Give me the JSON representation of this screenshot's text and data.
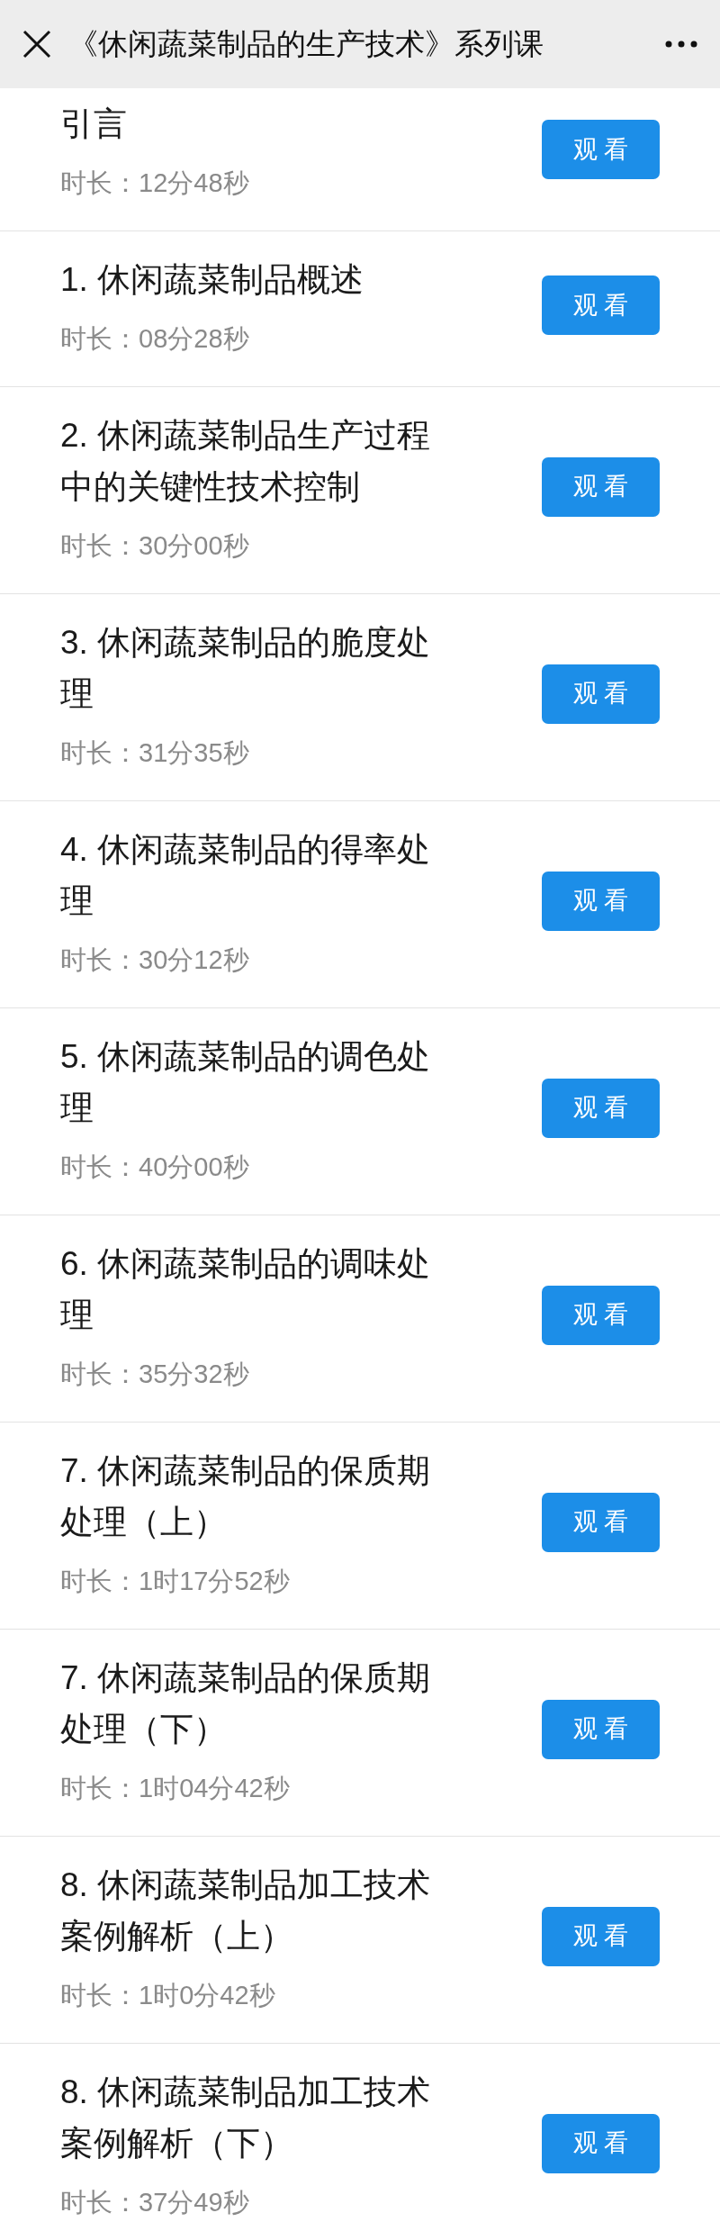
{
  "header": {
    "title": "《休闲蔬菜制品的生产技术》系列课"
  },
  "lessons": [
    {
      "title": "引言",
      "duration": "时长：12分48秒",
      "button": "观 看"
    },
    {
      "title": "1. 休闲蔬菜制品概述",
      "duration": "时长：08分28秒",
      "button": "观 看"
    },
    {
      "title": "2. 休闲蔬菜制品生产过程中的关键性技术控制",
      "duration": "时长：30分00秒",
      "button": "观 看"
    },
    {
      "title": "3. 休闲蔬菜制品的脆度处理",
      "duration": "时长：31分35秒",
      "button": "观 看"
    },
    {
      "title": "4. 休闲蔬菜制品的得率处理",
      "duration": "时长：30分12秒",
      "button": "观 看"
    },
    {
      "title": "5. 休闲蔬菜制品的调色处理",
      "duration": "时长：40分00秒",
      "button": "观 看"
    },
    {
      "title": "6. 休闲蔬菜制品的调味处理",
      "duration": "时长：35分32秒",
      "button": "观 看"
    },
    {
      "title": "7. 休闲蔬菜制品的保质期处理（上）",
      "duration": "时长：1时17分52秒",
      "button": "观 看"
    },
    {
      "title": "7. 休闲蔬菜制品的保质期处理（下）",
      "duration": "时长：1时04分42秒",
      "button": "观 看"
    },
    {
      "title": "8. 休闲蔬菜制品加工技术案例解析（上）",
      "duration": "时长：1时0分42秒",
      "button": "观 看"
    },
    {
      "title": "8. 休闲蔬菜制品加工技术案例解析（下）",
      "duration": "时长：37分49秒",
      "button": "观 看"
    }
  ]
}
